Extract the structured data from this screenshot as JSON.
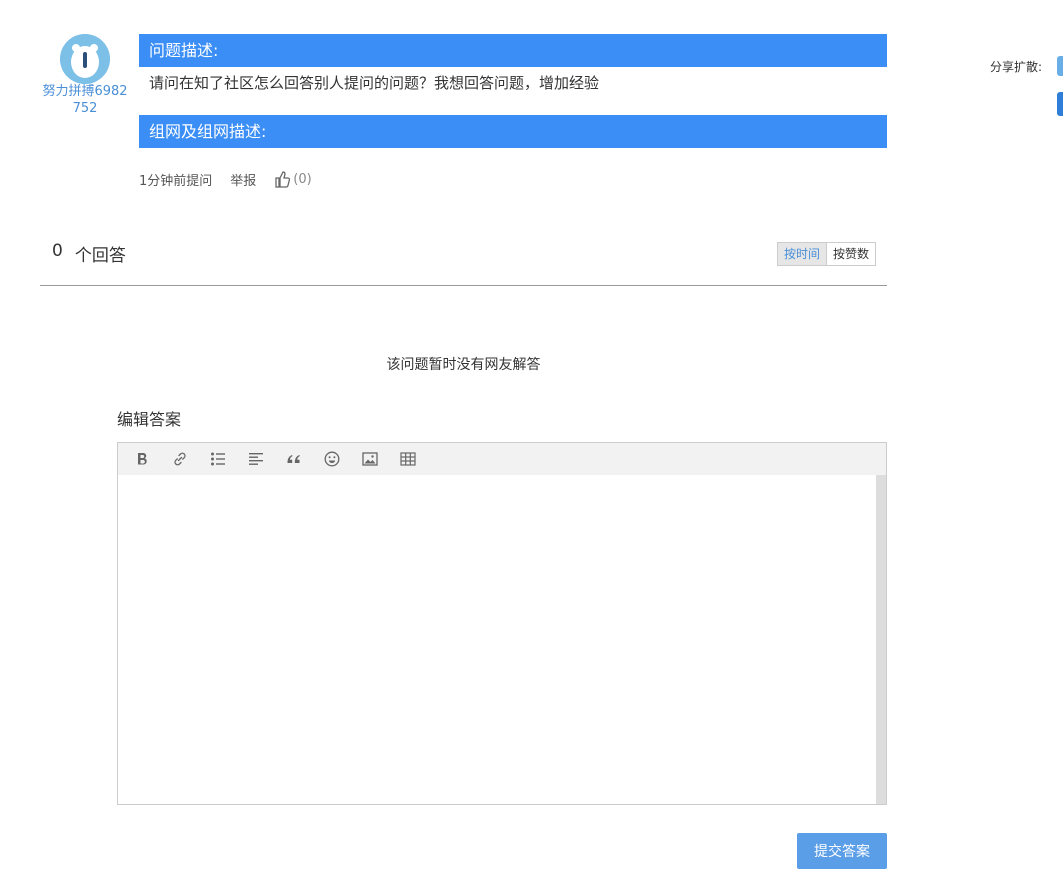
{
  "user": {
    "name": "努力拼搏6982752"
  },
  "question": {
    "desc_header": "问题描述:",
    "desc_text": "请问在知了社区怎么回答别人提问的问题？我想回答问题，增加经验",
    "network_header": "组网及组网描述:",
    "time": "1分钟前提问",
    "report": "举报",
    "likes": "(0)"
  },
  "answers": {
    "count": "0",
    "count_label": "个回答",
    "sort_time": "按时间",
    "sort_likes": "按赞数",
    "empty": "该问题暂时没有网友解答"
  },
  "editor": {
    "title": "编辑答案",
    "toolbar": [
      "bold-icon",
      "link-icon",
      "list-icon",
      "align-icon",
      "quote-icon",
      "emoji-icon",
      "image-icon",
      "table-icon"
    ],
    "submit": "提交答案"
  },
  "share": {
    "label": "分享扩散:"
  },
  "colors": {
    "accent": "#3a8ef6",
    "link": "#4a8fd8",
    "submit": "#5b9ee8"
  }
}
